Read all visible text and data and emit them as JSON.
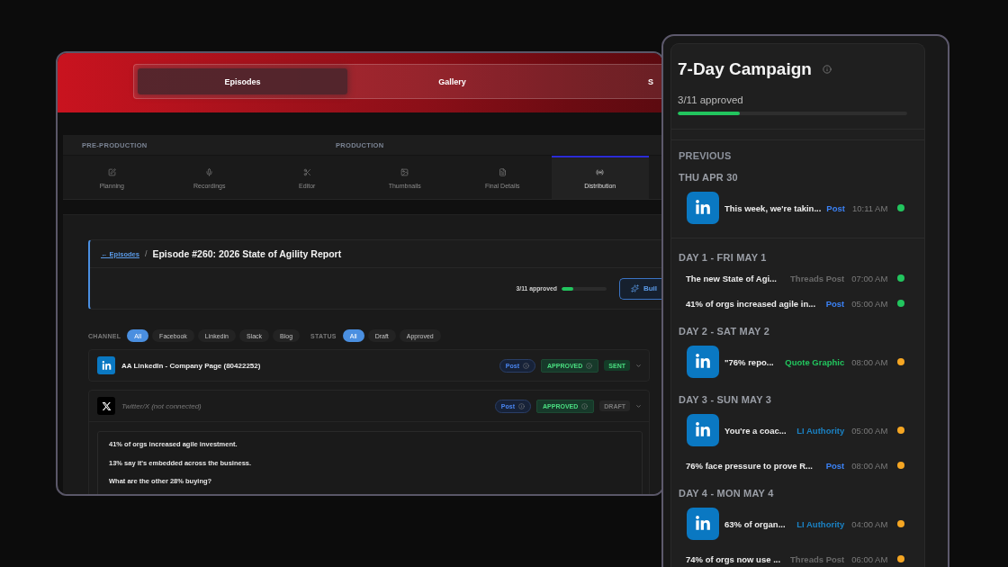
{
  "left_window": {
    "header_tabs": [
      {
        "label": "Episodes",
        "selected": true
      },
      {
        "label": "Gallery",
        "selected": false
      },
      {
        "label": "S",
        "selected": false
      }
    ],
    "stages": [
      "PRE-PRODUCTION",
      "PRODUCTION"
    ],
    "steps": [
      {
        "label": "Planning",
        "selected": false
      },
      {
        "label": "Recordings",
        "selected": false
      },
      {
        "label": "Editor",
        "selected": false
      },
      {
        "label": "Thumbnails",
        "selected": false
      },
      {
        "label": "Final Details",
        "selected": false
      },
      {
        "label": "Distribution",
        "selected": true
      }
    ],
    "breadcrumb": {
      "link": "← Episodes",
      "separator": "/",
      "title": "Episode #260: 2026 State of Agility Report"
    },
    "approval": {
      "text": "3/11 approved",
      "level": 0.27
    },
    "build_button": {
      "label": "Buil"
    },
    "filters": [
      {
        "label": "CHANNEL",
        "options": [
          {
            "label": "All",
            "selected": true
          },
          {
            "label": "Facebook",
            "selected": false
          },
          {
            "label": "Linkedin",
            "selected": false
          },
          {
            "label": "Slack",
            "selected": false
          },
          {
            "label": "Blog",
            "selected": false
          }
        ]
      },
      {
        "label": "STATUS",
        "options": [
          {
            "label": "All",
            "selected": true
          },
          {
            "label": "Draft",
            "selected": false
          },
          {
            "label": "Approved",
            "selected": false
          }
        ]
      }
    ],
    "channels": [
      {
        "kind": "linkedin",
        "name": "AA LinkedIn - Company Page (80422252)",
        "connected": true,
        "expanded": false,
        "badges": [
          {
            "kind": "type",
            "label": "Post"
          },
          {
            "kind": "approval",
            "label": "APPROVED"
          },
          {
            "kind": "sent",
            "label": "SENT"
          }
        ]
      },
      {
        "kind": "x",
        "name": "Twitter/X (not connected)",
        "connected": false,
        "expanded": true,
        "badges": [
          {
            "kind": "type",
            "label": "Post"
          },
          {
            "kind": "approval",
            "label": "APPROVED"
          },
          {
            "kind": "draft",
            "label": "DRAFT"
          }
        ],
        "body": [
          "41% of orgs increased agile investment.",
          "13% say it's embedded across the business.",
          "What are the other 28% buying?"
        ]
      }
    ]
  },
  "campaign": {
    "title": "7-Day Campaign",
    "approval": {
      "text": "3/11 approved",
      "level": 0.27
    },
    "previous": {
      "heading": "PREVIOUS",
      "days": [
        {
          "label": "THU APR 30",
          "items": [
            {
              "kind": "linkedin",
              "text": "This week, we're takin...",
              "type": {
                "label": "Post",
                "color": "#3b82f6"
              },
              "time": "10:11 AM",
              "color": "#22c55e"
            }
          ]
        }
      ]
    },
    "days": [
      {
        "label": "DAY 1 - FRI MAY 1",
        "items": [
          {
            "kind": "plain",
            "text": "The new State of Agi...",
            "type": {
              "label": "Threads Post",
              "color": "#6a6a6a"
            },
            "time": "07:00 AM",
            "color": "#22c55e"
          },
          {
            "kind": "plain",
            "text": "41% of orgs increased agile in...",
            "type": {
              "label": "Post",
              "color": "#3b82f6"
            },
            "time": "05:00 AM",
            "color": "#22c55e"
          }
        ]
      },
      {
        "label": "DAY 2 - SAT MAY 2",
        "items": [
          {
            "kind": "linkedin",
            "text": "\"76% repo...",
            "type": {
              "label": "Quote Graphic",
              "color": "#22c55e"
            },
            "time": "08:00 AM",
            "color": "#f5a623"
          }
        ]
      },
      {
        "label": "DAY 3 - SUN MAY 3",
        "items": [
          {
            "kind": "linkedin",
            "text": "You're a coac...",
            "type": {
              "label": "LI Authority",
              "color": "#1b82c4"
            },
            "time": "05:00 AM",
            "color": "#f5a623"
          },
          {
            "kind": "plain",
            "text": "76% face pressure to prove R...",
            "type": {
              "label": "Post",
              "color": "#3b82f6"
            },
            "time": "08:00 AM",
            "color": "#f5a623"
          }
        ]
      },
      {
        "label": "DAY 4 - MON MAY 4",
        "items": [
          {
            "kind": "linkedin",
            "text": "63% of organ...",
            "type": {
              "label": "LI Authority",
              "color": "#1b82c4"
            },
            "time": "04:00 AM",
            "color": "#f5a623"
          },
          {
            "kind": "plain",
            "text": "74% of orgs now use ...",
            "type": {
              "label": "Threads Post",
              "color": "#6a6a6a"
            },
            "time": "06:00 AM",
            "color": "#f5a623"
          }
        ]
      }
    ]
  }
}
